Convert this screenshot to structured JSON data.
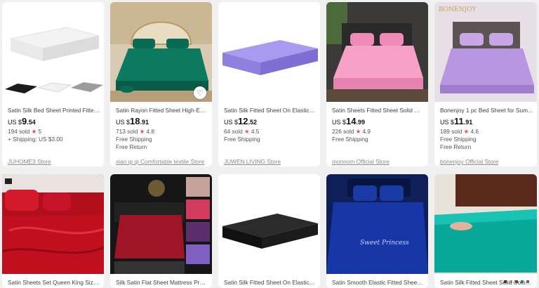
{
  "products_row1": [
    {
      "title": "Satin Silk Bed Sheet Printed Fitted ...",
      "currency": "US $",
      "price_int": "9",
      "price_dec": ".54",
      "sold": "194 sold",
      "rating": "5",
      "lines": [
        "+ Shipping: US $3.00"
      ],
      "store": "JUHOME3 Store"
    },
    {
      "title": "Satin Rayon Fitted Sheet High-End ...",
      "currency": "US $",
      "price_int": "18",
      "price_dec": ".91",
      "sold": "713 sold",
      "rating": "4.8",
      "lines": [
        "Free Shipping",
        "Free Return"
      ],
      "store": "xiao qi qi Comfortable textile Store"
    },
    {
      "title": "Satin Silk Fitted Sheet On Elastic B...",
      "currency": "US $",
      "price_int": "12",
      "price_dec": ".52",
      "sold": "64 sold",
      "rating": "4.5",
      "lines": [
        "Free Shipping"
      ],
      "store": "JUWEN LIVING Store"
    },
    {
      "title": "Satin Sheets Fitted Sheet Solid Col...",
      "currency": "US $",
      "price_int": "14",
      "price_dec": ".99",
      "sold": "226 sold",
      "rating": "4.9",
      "lines": [
        "Free Shipping"
      ],
      "store": "monnom Official Store"
    },
    {
      "title": "Bonenjoy 1 pc Bed Sheet for Sum...",
      "currency": "US $",
      "price_int": "11",
      "price_dec": ".91",
      "sold": "189 sold",
      "rating": "4.6",
      "lines": [
        "Free Shipping",
        "Free Return"
      ],
      "store": "bonenjoy Official Store"
    }
  ],
  "products_row2": [
    {
      "title": "Satin Sheets Set Queen King Size F..."
    },
    {
      "title": "Silk Satin Flat Sheet Mattress Prote..."
    },
    {
      "title": "Satin Silk Fitted Sheet On Elastic S..."
    },
    {
      "title": "Satin Smooth Elastic Fitted Sheet C..."
    },
    {
      "title": "Satin Silk Fitted Sheet Solid Color B..."
    }
  ],
  "brand_logo_text": "BONENJOY",
  "pillow_embroidery": "Sweet Princess",
  "star_symbol": "★",
  "heart_symbol": "♡",
  "colors": {
    "star": "#ff4747",
    "background": "#f0f0f0",
    "card": "#ffffff"
  }
}
